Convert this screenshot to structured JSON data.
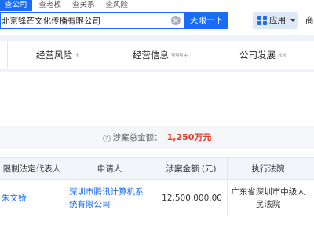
{
  "tabs": [
    "查公司",
    "查老板",
    "查关系",
    "查风险"
  ],
  "search": {
    "value": "北京锋芒文化传播有限公司",
    "button": "天眼一下"
  },
  "toolbar": {
    "app_label": "应用",
    "shop_label": "商"
  },
  "nav": [
    {
      "label": "经营风险",
      "count": "3"
    },
    {
      "label": "经营信息",
      "count": "999+"
    },
    {
      "label": "公司发展",
      "count": "88"
    }
  ],
  "summary": {
    "label": "涉案总金额：",
    "amount": "1,250万元"
  },
  "table": {
    "headers": [
      "限制法定代表人",
      "申请人",
      "涉案金额 (元)",
      "执行法院"
    ],
    "rows": [
      {
        "representative": "朱文娇",
        "applicant": "深圳市腾讯计算机系统有限公司",
        "amount": "12,500,000.00",
        "court": "广东省深圳市中级人民法院"
      }
    ]
  },
  "colors": {
    "accent": "#1a6cf5",
    "amount_red": "#e03b2f"
  }
}
